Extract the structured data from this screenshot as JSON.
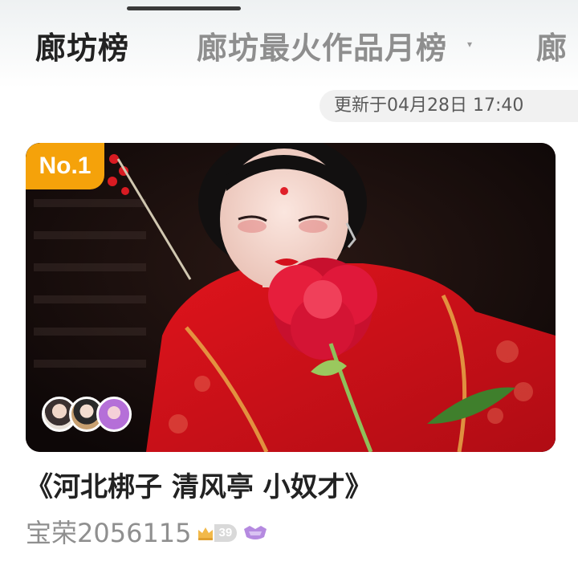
{
  "tabs": [
    {
      "label": "廊坊榜",
      "active": true
    },
    {
      "label": "廊坊最火作品月榜",
      "active": false
    },
    {
      "label": "廊",
      "active": false
    }
  ],
  "update_time": "更新于04月28日 17:40",
  "item": {
    "rank_label": "No.1",
    "title": "《河北梆子 清风亭 小奴才》",
    "author": "宝荣2056115",
    "level": "39",
    "avatars": [
      "avatar-1",
      "avatar-2",
      "avatar-3"
    ]
  },
  "colors": {
    "rank_badge": "#f5a20a",
    "active_tab": "#222222",
    "inactive_tab": "#8e8e8e"
  },
  "icons": {
    "tab_caret": "caret-down-icon",
    "crown": "crown-icon",
    "fan": "fan-badge-icon"
  }
}
